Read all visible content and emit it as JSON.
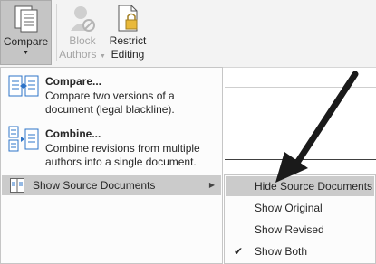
{
  "ribbon": {
    "compare": {
      "label": "Compare"
    },
    "block_authors": {
      "line1": "Block",
      "line2": "Authors"
    },
    "restrict_editing": {
      "line1": "Restrict",
      "line2": "Editing"
    }
  },
  "menu": {
    "items": [
      {
        "title": "Compare...",
        "desc_line1": "Compare two versions of a",
        "desc_line2": "document (legal blackline)."
      },
      {
        "title": "Combine...",
        "desc_line1": "Combine revisions from multiple",
        "desc_line2": "authors into a single document."
      }
    ],
    "show_source": {
      "label": "Show Source Documents"
    }
  },
  "submenu": {
    "items": [
      {
        "label": "Hide Source Documents",
        "highlighted": true,
        "checked": false
      },
      {
        "label": "Show Original",
        "highlighted": false,
        "checked": false
      },
      {
        "label": "Show Revised",
        "highlighted": false,
        "checked": false
      },
      {
        "label": "Show Both",
        "highlighted": false,
        "checked": true
      }
    ]
  },
  "colors": {
    "highlight": "#cbcbcb",
    "accent_blue": "#2e74c8",
    "disabled_text": "#a6a6a6"
  }
}
